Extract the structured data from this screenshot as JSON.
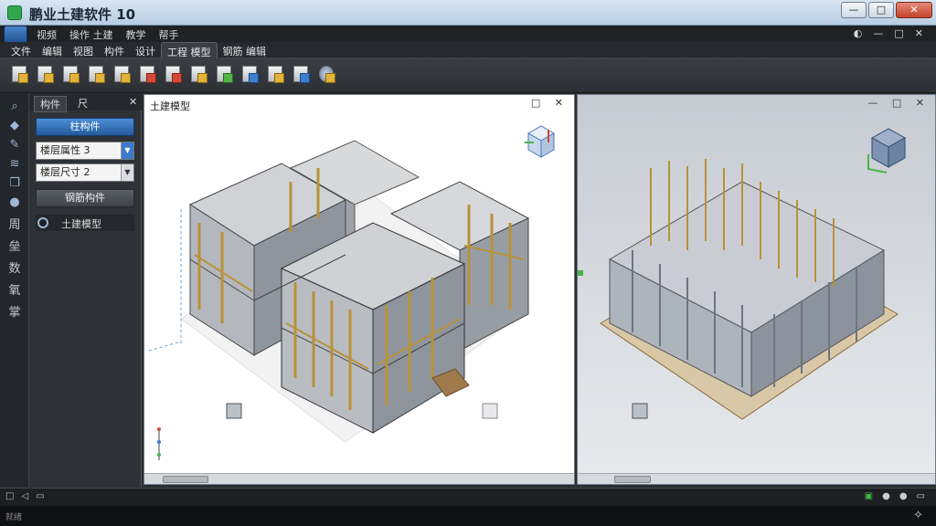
{
  "window": {
    "title": "鹏业土建软件 10",
    "buttons": {
      "min": "—",
      "max": "□",
      "close": "✕"
    }
  },
  "menubar": {
    "items": [
      "视频",
      "操作 土建",
      "教学",
      "帮手"
    ],
    "right": [
      "◐",
      "—",
      "□",
      "✕"
    ]
  },
  "tabs": [
    {
      "label": "文件",
      "active": false
    },
    {
      "label": "编辑",
      "active": false
    },
    {
      "label": "视图",
      "active": false
    },
    {
      "label": "构件",
      "active": false
    },
    {
      "label": "设计",
      "active": false
    },
    {
      "label": "工程 模型",
      "active": true
    },
    {
      "label": "钢筋 编辑",
      "active": false
    }
  ],
  "ribbon_tools": [
    "yellow",
    "yellow",
    "yellow",
    "yellow",
    "yellow",
    "red",
    "red",
    "yellow",
    "green",
    "blue",
    "yellow",
    "blue",
    "gear"
  ],
  "vtool": {
    "icons": [
      "search-icon",
      "cube-icon",
      "pen-icon",
      "layers-icon",
      "copy-icon",
      "pin-icon"
    ],
    "chars": [
      "周",
      "垒",
      "数",
      "氧",
      "掌"
    ]
  },
  "left_panel": {
    "tabs": [
      "构件",
      "尺"
    ],
    "close": "✕",
    "primary_button": "柱构件",
    "select1": "楼层属性 3",
    "select2": "楼层尺寸 2",
    "grey_button": "钢筋构件",
    "radio_label": "土建模型"
  },
  "viewport1": {
    "title": "土建模型",
    "controls": "□ ✕"
  },
  "viewport2": {
    "title": "",
    "controls": "— □ ✕"
  },
  "statusbar": {
    "left": [
      "□",
      "◁",
      "▭"
    ],
    "right": [
      "▣",
      "●",
      "●",
      "▭"
    ]
  },
  "taskbar": {
    "left": "就绪",
    "right": "✧"
  }
}
